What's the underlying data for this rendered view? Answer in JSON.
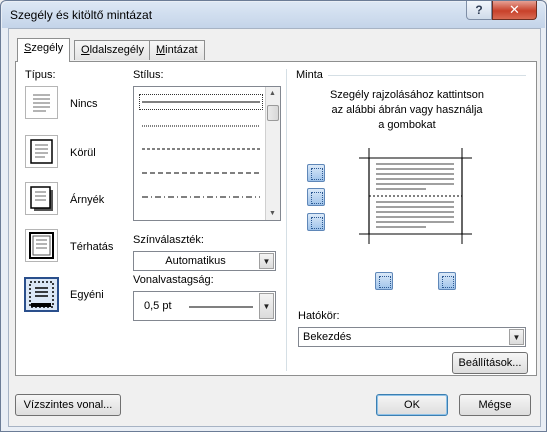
{
  "window": {
    "title": "Szegély és kitöltő mintázat",
    "help": "?",
    "close": "✕"
  },
  "tabs": [
    {
      "label": "Szegély",
      "mnemonic": "S",
      "rest": "zegély",
      "active": true
    },
    {
      "label": "Oldalszegély",
      "mnemonic": "O",
      "rest": "ldalszegély",
      "active": false
    },
    {
      "label": "Mintázat",
      "mnemonic": "M",
      "rest": "intázat",
      "active": false
    }
  ],
  "type_section": {
    "label": "Típus:",
    "presets": [
      {
        "label": "Nincs",
        "icon": "no-border-icon"
      },
      {
        "label": "Körül",
        "icon": "box-border-icon"
      },
      {
        "label": "Árnyék",
        "icon": "shadow-border-icon"
      },
      {
        "label": "Térhatás",
        "icon": "3d-border-icon"
      },
      {
        "label": "Egyéni",
        "icon": "custom-border-icon",
        "selected": true
      }
    ]
  },
  "style_section": {
    "label": "Stílus:",
    "styles": [
      "solid",
      "dotted-fine",
      "dashed-small",
      "dashed-medium",
      "dash-dot"
    ]
  },
  "color": {
    "label": "Színválaszték:",
    "value": "Automatikus"
  },
  "width": {
    "label": "Vonalvastagság:",
    "value": "0,5 pt"
  },
  "preview": {
    "label": "Minta",
    "description": [
      "Szegély rajzolásához kattintson",
      "az alábbi ábrán vagy használja",
      "a gombokat"
    ]
  },
  "scope": {
    "label": "Hatókör:",
    "value": "Bekezdés"
  },
  "buttons": {
    "options": "Beállítások...",
    "horizontal": "Vízszintes vonal...",
    "ok": "OK",
    "cancel": "Mégse"
  }
}
